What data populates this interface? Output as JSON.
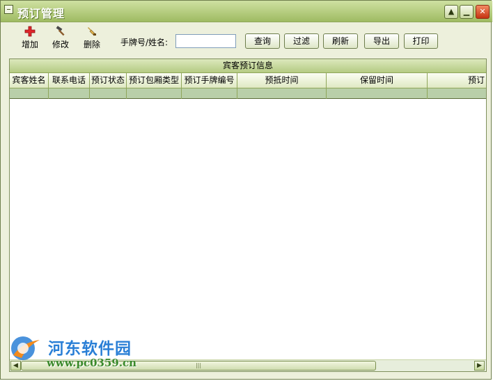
{
  "window": {
    "title": "预订管理",
    "controls": {
      "minimize": "▲",
      "restore": "▁",
      "close": "✕"
    }
  },
  "toolbar": {
    "add": {
      "label": "增加",
      "icon": "add-icon"
    },
    "edit": {
      "label": "修改",
      "icon": "hammer-icon"
    },
    "delete": {
      "label": "删除",
      "icon": "delete-icon"
    },
    "search_label": "手牌号/姓名:",
    "search_value": "",
    "buttons": {
      "query": "查询",
      "filter": "过滤",
      "refresh": "刷新",
      "export": "导出",
      "print": "打印"
    }
  },
  "grid": {
    "caption": "宾客预订信息",
    "columns": [
      "宾客姓名",
      "联系电话",
      "预订状态",
      "预订包厢类型",
      "预订手牌编号",
      "预抵时间",
      "保留时间",
      "预订"
    ]
  },
  "watermark": {
    "title": "河东软件园",
    "url": "www.pc0359.cn"
  },
  "colors": {
    "accent": "#9fbb62",
    "close": "#c53312",
    "selection": "#b9cfa9"
  }
}
